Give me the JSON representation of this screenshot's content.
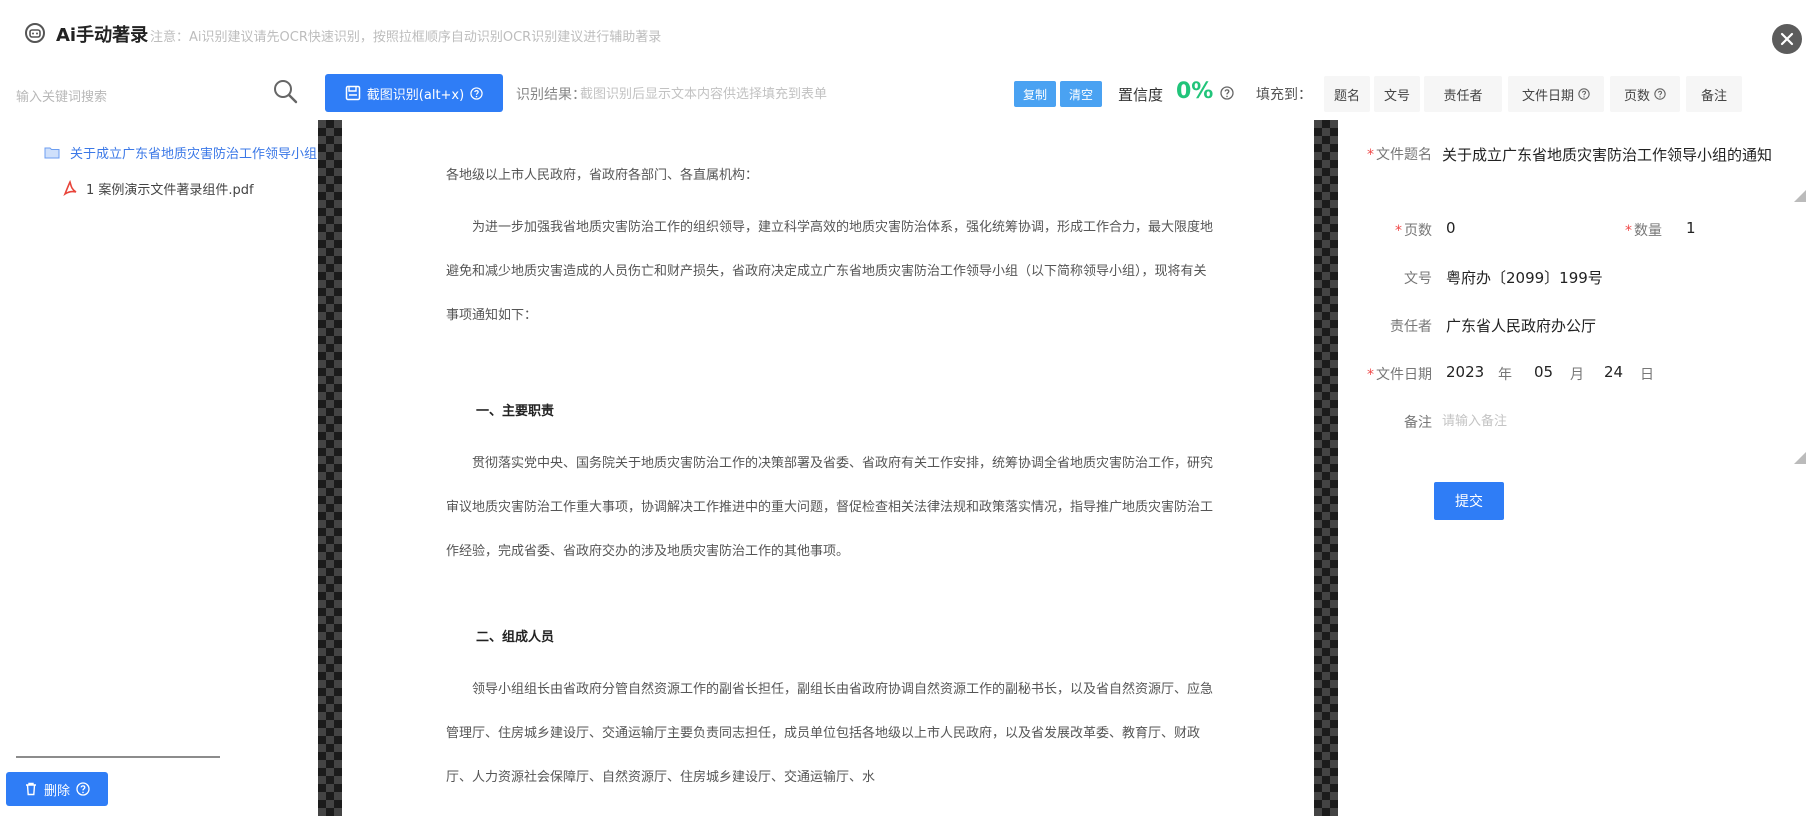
{
  "window": {
    "title": "Ai手动著录",
    "hint": "注意：Ai识别建议请先OCR快速识别，按照拉框顺序自动识别OCR识别建议进行辅助著录",
    "close_icon": "close-icon"
  },
  "left_panel": {
    "search_placeholder": "输入关键词搜索",
    "tree": {
      "root_label": "关于成立广东省地质灾害防治工作领导小组的通知",
      "children": [
        {
          "label": "1 案例演示文件著录组件.pdf"
        }
      ]
    },
    "delete_label": "删除"
  },
  "toolbar": {
    "capture_label": "截图识别(alt+x)",
    "rec_label": "识别结果：",
    "rec_placeholder": "截图识别后显示文本内容供选择填充到表单",
    "copy_label": "复制",
    "clear_label": "清空",
    "confidence_label": "置信度",
    "confidence_value": "0%",
    "fill_label": "填充到：",
    "fields": [
      "题名",
      "文号",
      "责任者",
      "文件日期",
      "页数",
      "备注"
    ]
  },
  "document": {
    "salutation": "各地级以上市人民政府，省政府各部门、各直属机构：",
    "para1": "为进一步加强我省地质灾害防治工作的组织领导，建立科学高效的地质灾害防治体系，强化统筹协调，形成工作合力，最大限度地避免和减少地质灾害造成的人员伤亡和财产损失，省政府决定成立广东省地质灾害防治工作领导小组（以下简称领导小组），现将有关事项通知如下：",
    "heading1": "一、主要职责",
    "para2": "贯彻落实党中央、国务院关于地质灾害防治工作的决策部署及省委、省政府有关工作安排，统筹协调全省地质灾害防治工作，研究审议地质灾害防治工作重大事项，协调解决工作推进中的重大问题，督促检查相关法律法规和政策落实情况，指导推广地质灾害防治工作经验，完成省委、省政府交办的涉及地质灾害防治工作的其他事项。",
    "heading2": "二、组成人员",
    "para3": "领导小组组长由省政府分管自然资源工作的副省长担任，副组长由省政府协调自然资源工作的副秘书长，以及省自然资源厅、应急管理厅、住房城乡建设厅、交通运输厅主要负责同志担任，成员单位包括各地级以上市人民政府，以及省发展改革委、教育厅、财政厅、人力资源社会保障厅、自然资源厅、住房城乡建设厅、交通运输厅、水"
  },
  "form": {
    "title_label": "文件题名",
    "title_value": "关于成立广东省地质灾害防治工作领导小组的通知",
    "pages_label": "页数",
    "pages_value": "0",
    "count_label": "数量",
    "count_value": "1",
    "docno_label": "文号",
    "docno_value": "粤府办〔2099〕199号",
    "author_label": "责任者",
    "author_value": "广东省人民政府办公厅",
    "date_label": "文件日期",
    "date_year": "2023",
    "date_month": "05",
    "date_day": "24",
    "unit_year": "年",
    "unit_month": "月",
    "unit_day": "日",
    "note_label": "备注",
    "note_placeholder": "请输入备注",
    "submit_label": "提交"
  },
  "colors": {
    "primary": "#2f7df6",
    "confidence": "#21c47a",
    "required": "#f04848"
  }
}
